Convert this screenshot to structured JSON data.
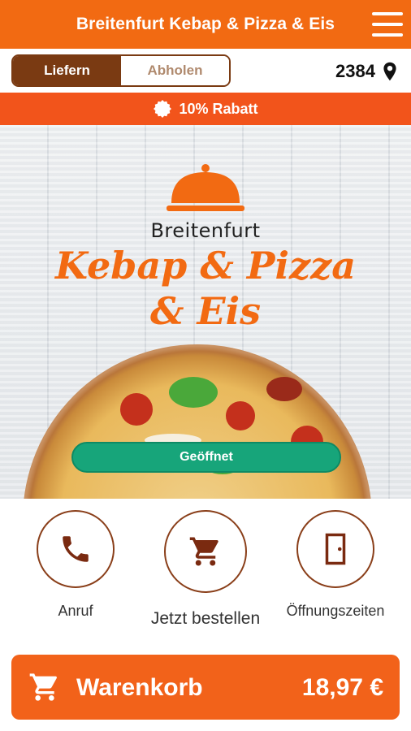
{
  "header": {
    "title": "Breitenfurt Kebap & Pizza & Eis",
    "menu_icon": "hamburger-menu-icon"
  },
  "mode_toggle": {
    "options": [
      {
        "label": "Liefern",
        "active": true
      },
      {
        "label": "Abholen",
        "active": false
      }
    ]
  },
  "location": {
    "postal_code": "2384",
    "icon": "location-pin-icon"
  },
  "discount_banner": {
    "text": "10% Rabatt",
    "icon": "discount-badge-icon"
  },
  "hero": {
    "logo_city": "Breitenfurt",
    "logo_line1": "Kebap & Pizza",
    "logo_line2": "& Eis",
    "status_label": "Geöffnet"
  },
  "actions": [
    {
      "label": "Anruf",
      "icon": "phone-icon"
    },
    {
      "label": "Jetzt bestellen",
      "icon": "cart-icon"
    },
    {
      "label": "Öffnungszeiten",
      "icon": "door-icon"
    }
  ],
  "cart": {
    "label": "Warenkorb",
    "total": "18,97 €",
    "icon": "cart-icon"
  },
  "colors": {
    "brand_orange": "#f26a12",
    "banner_orange": "#f2541b",
    "brown": "#7a3a12",
    "open_green": "#17a57a"
  }
}
